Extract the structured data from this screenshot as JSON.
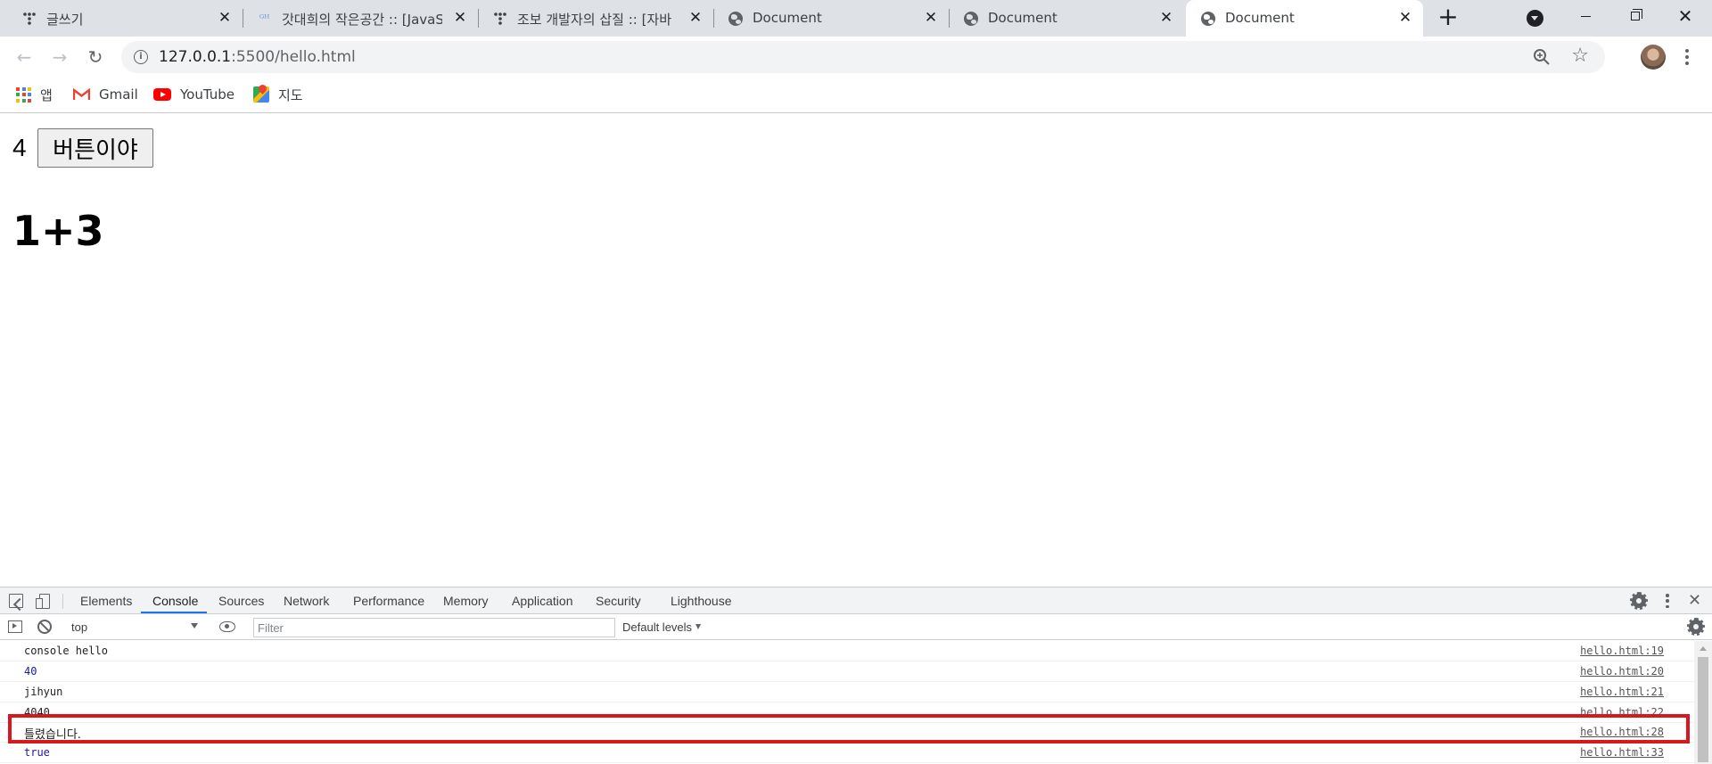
{
  "tabs": [
    {
      "title": "글쓰기",
      "favicon": "tistory-icon",
      "active": false
    },
    {
      "title": "갓대희의 작은공간 :: [JavaS",
      "favicon": "blog-icon",
      "active": false
    },
    {
      "title": "조보 개발자의 삽질 :: [자바",
      "favicon": "tistory-icon",
      "active": false
    },
    {
      "title": "Document",
      "favicon": "globe-icon",
      "active": false
    },
    {
      "title": "Document",
      "favicon": "globe-icon",
      "active": false
    },
    {
      "title": "Document",
      "favicon": "globe-icon",
      "active": true
    }
  ],
  "address_bar": {
    "host": "127.0.0.1",
    "path": ":5500/hello.html"
  },
  "bookmarks": [
    {
      "label": "앱",
      "icon": "apps-icon"
    },
    {
      "label": "Gmail",
      "icon": "gmail-icon"
    },
    {
      "label": "YouTube",
      "icon": "youtube-icon"
    },
    {
      "label": "지도",
      "icon": "maps-icon"
    }
  ],
  "page": {
    "counter": "4",
    "button_label": "버튼이야",
    "heading": "1+3"
  },
  "devtools": {
    "tabs": [
      "Elements",
      "Console",
      "Sources",
      "Network",
      "Performance",
      "Memory",
      "Application",
      "Security",
      "Lighthouse"
    ],
    "active_tab": "Console",
    "context": "top",
    "filter_placeholder": "Filter",
    "levels": "Default levels",
    "console_rows": [
      {
        "message": "console hello",
        "source": "hello.html:19",
        "type": "text"
      },
      {
        "message": "40",
        "source": "hello.html:20",
        "type": "number"
      },
      {
        "message": "jihyun",
        "source": "hello.html:21",
        "type": "text"
      },
      {
        "message": "4040",
        "source": "hello.html:22",
        "type": "text"
      },
      {
        "message": "틀렸습니다.",
        "source": "hello.html:28",
        "type": "text"
      },
      {
        "message": "true",
        "source": "hello.html:33",
        "type": "number"
      }
    ]
  },
  "colors": {
    "tabstrip": "#dee1e6",
    "accent": "#1a73e8",
    "highlight_border": "#d7191f"
  }
}
